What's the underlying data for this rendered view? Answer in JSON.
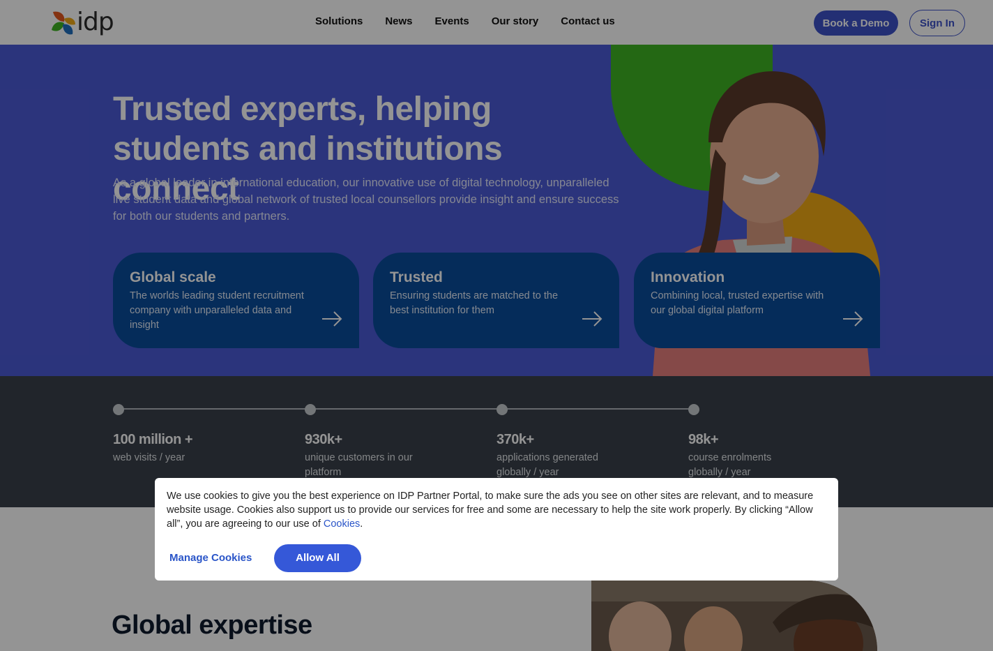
{
  "header": {
    "logo_text": "idp",
    "nav": [
      "Solutions",
      "News",
      "Events",
      "Our story",
      "Contact us"
    ],
    "book_demo": "Book a Demo",
    "sign_in": "Sign In"
  },
  "hero": {
    "title": "Trusted experts, helping students and institutions connect",
    "subtitle": "As a global leader in international education, our innovative use of digital technology, unparalleled live student data and global network of trusted local counsellors provide insight and ensure success for both our students and partners.",
    "cards": [
      {
        "title": "Global scale",
        "text": "The worlds leading student recruitment company with unparalleled data and insight"
      },
      {
        "title": "Trusted",
        "text": "Ensuring students are matched to the best institution for them"
      },
      {
        "title": "Innovation",
        "text": "Combining local, trusted expertise with our global digital platform"
      }
    ]
  },
  "stats": [
    {
      "value": "100 million +",
      "label": "web visits / year"
    },
    {
      "value": "930k+",
      "label": "unique customers in our platform"
    },
    {
      "value": "370k+",
      "label": "applications generated globally / year"
    },
    {
      "value": "98k+",
      "label": "course enrolments globally / year"
    }
  ],
  "section": {
    "title": "Global expertise"
  },
  "cookie": {
    "text": "We use cookies to give you the best experience on IDP Partner Portal, to make sure the ads you see on other sites are relevant, and to measure website usage. Cookies also support us to provide our services for free and some are necessary to help the site work properly. By clicking “Allow all”, you are agreeing to our use of ",
    "link": "Cookies",
    "suffix": ".",
    "manage": "Manage Cookies",
    "allow": "Allow All"
  },
  "colors": {
    "brand_blue": "#4b5ad6",
    "card_blue": "#0a4c9c",
    "green": "#3fb323",
    "orange": "#f0a916",
    "dark": "#39414a"
  }
}
